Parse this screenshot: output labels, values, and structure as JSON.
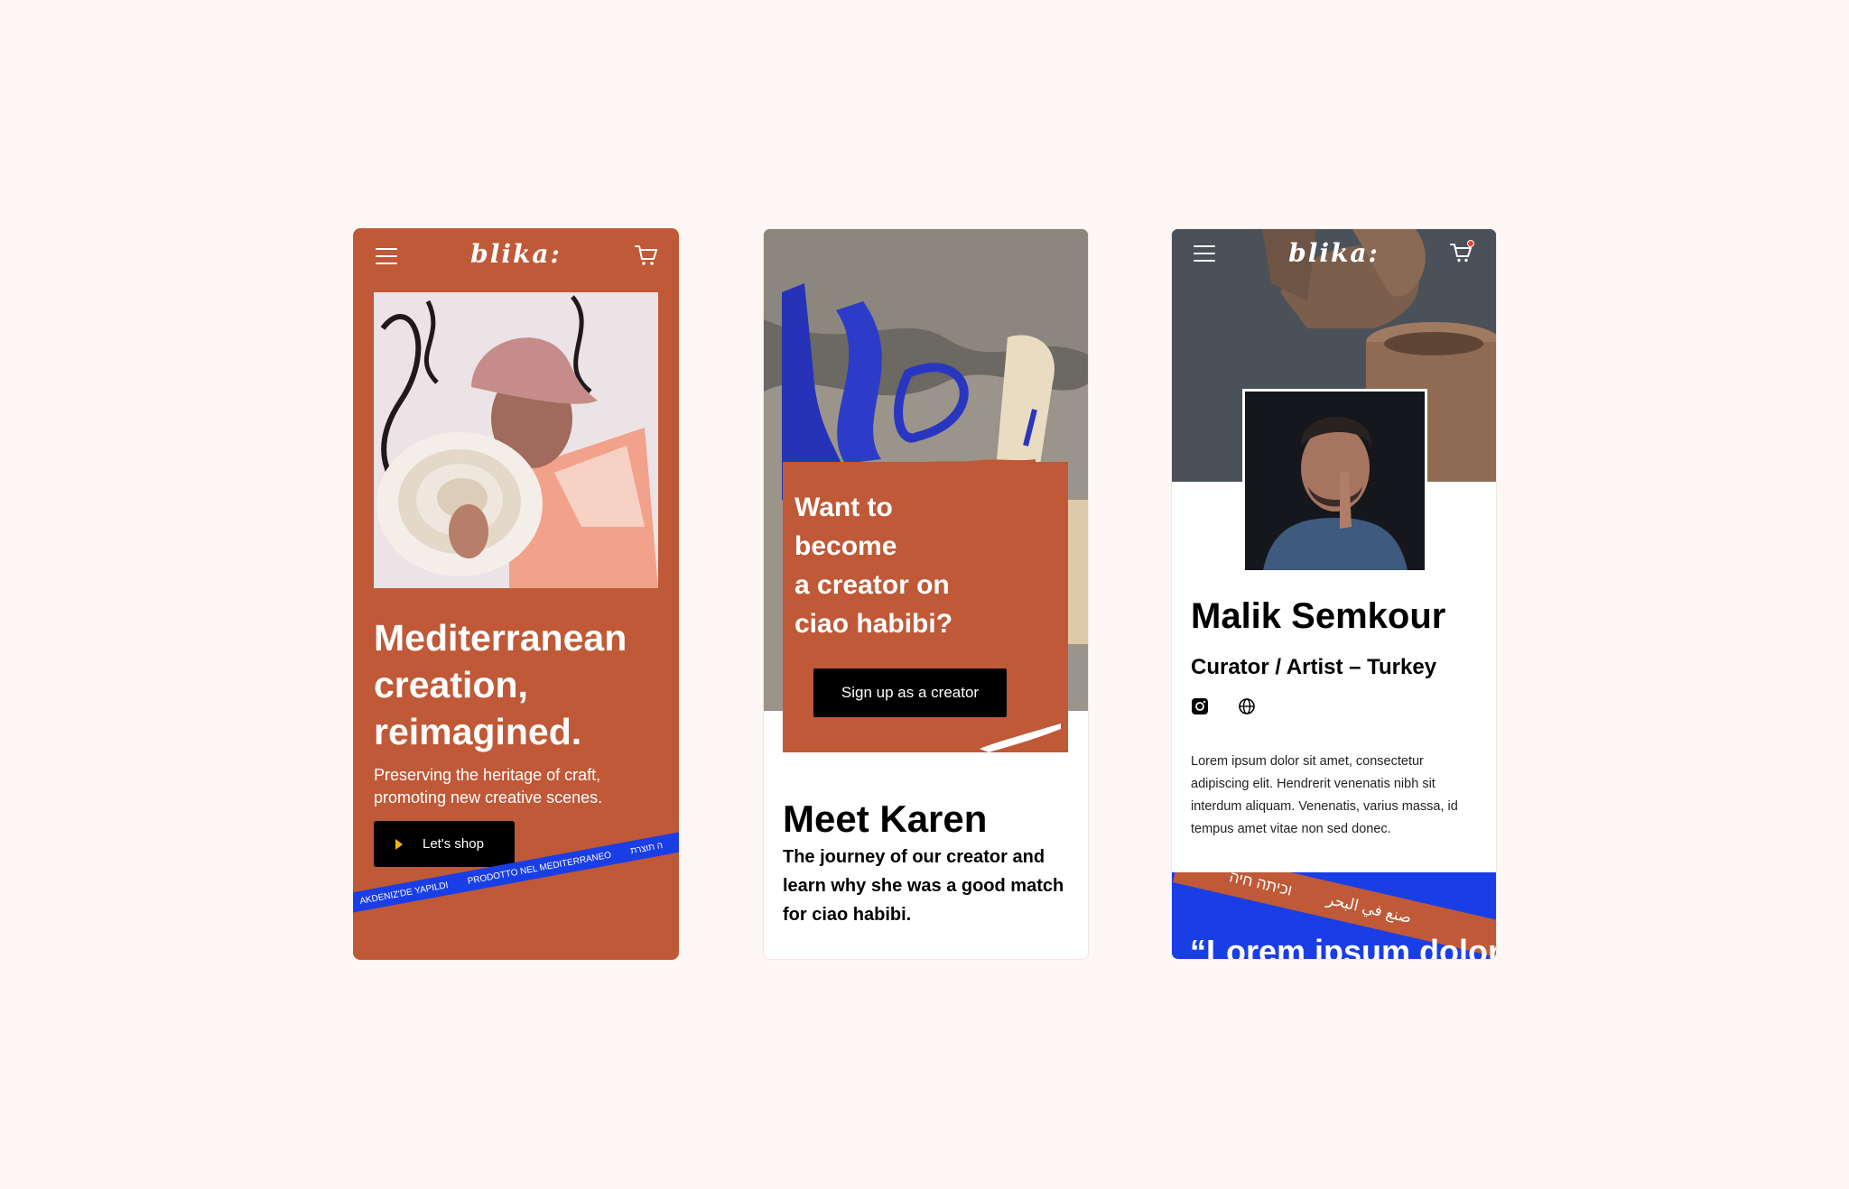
{
  "brand": {
    "logo": "blika:",
    "accent": "#bf5937",
    "blue": "#1a3ee6"
  },
  "screen1": {
    "headline": [
      "Mediterranean",
      "creation,",
      "reimagined."
    ],
    "subtitle": "Preserving the heritage of craft, promoting new creative scenes.",
    "cta": "Let's shop",
    "ribbon": [
      "AKDENIZ'DE YAPILDI",
      "PRODOTTO NEL MEDITERRANEO",
      "ה תוצרת"
    ]
  },
  "screen2": {
    "card_title": [
      "Want to",
      "become",
      "a creator on",
      "ciao habibi?"
    ],
    "cta": "Sign up as a creator",
    "section_title": "Meet Karen",
    "section_text": "The journey of our creator and learn why she was a good match for ciao habibi."
  },
  "screen3": {
    "name": "Malik Semkour",
    "role": "Curator / Artist – Turkey",
    "bio": "Lorem ipsum dolor sit amet, consectetur adipiscing elit. Hendrerit venenatis nibh sit interdum aliquam. Venenatis, varius massa, id tempus amet vitae non sed donec.",
    "strip": [
      "וכיתה חיה",
      "صنع في البحر"
    ],
    "quote": "“Lorem ipsum dolor"
  }
}
